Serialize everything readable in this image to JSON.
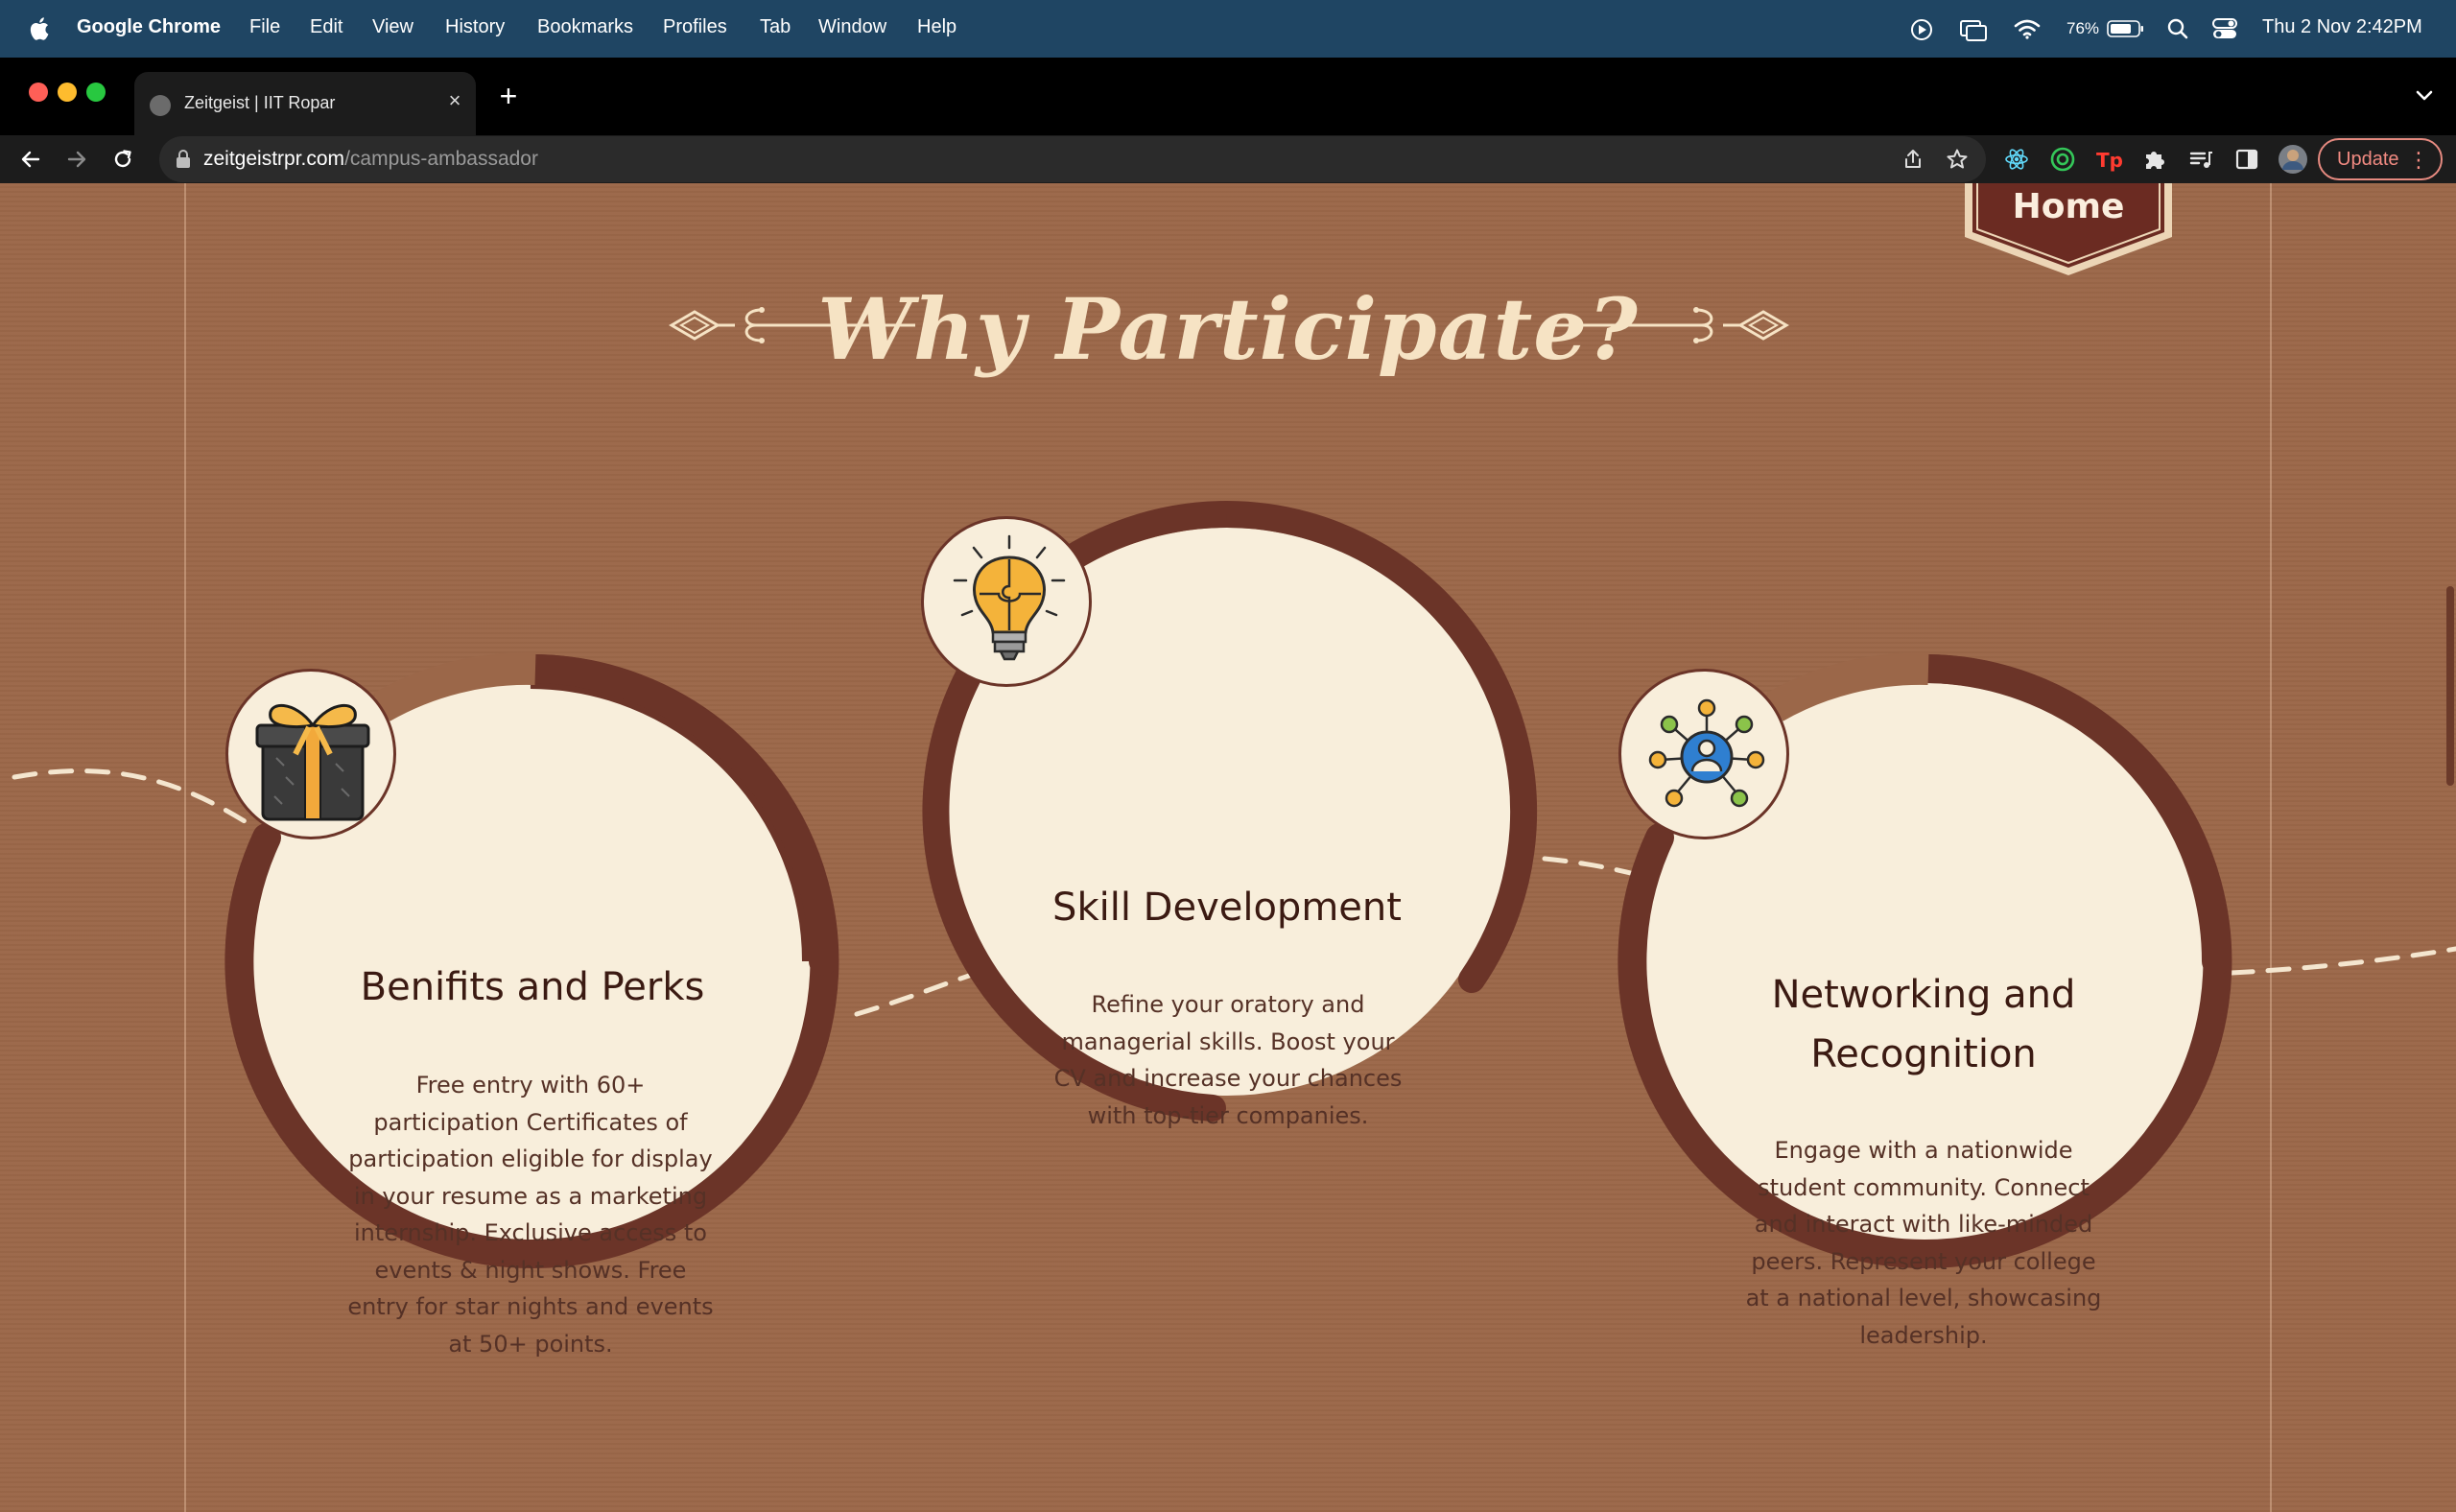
{
  "menubar": {
    "app_name": "Google Chrome",
    "items": [
      "File",
      "Edit",
      "View",
      "History",
      "Bookmarks",
      "Profiles",
      "Tab",
      "Window",
      "Help"
    ],
    "battery": "76%",
    "datetime": "Thu 2 Nov  2:42PM"
  },
  "browser": {
    "tab_title": "Zeitgeist | IIT Ropar",
    "url_host": "zeitgeistrpr.com",
    "url_path": "/campus-ambassador",
    "update_label": "Update"
  },
  "page": {
    "home_label": "Home",
    "section_title": "Why Participate?",
    "cards": [
      {
        "title": "Benifits and Perks",
        "body_lines": [
          "Free entry with 60+",
          "participation Certificates of",
          "participation eligible for display",
          "in your resume as a marketing",
          "internship. Exclusive access to",
          "events & night shows. Free",
          "entry for star nights and events",
          "at 50+ points."
        ],
        "icon": "gift-icon"
      },
      {
        "title": "Skill Development",
        "body_lines": [
          "Refine your oratory and",
          "managerial skills. Boost your",
          "CV and increase your chances",
          "with top-tier companies."
        ],
        "icon": "lightbulb-puzzle-icon"
      },
      {
        "title_lines": [
          "Networking and",
          "Recognition"
        ],
        "body_lines": [
          "Engage with a nationwide",
          "student community. Connect",
          "and interact with like-minded",
          "peers. Represent your college",
          "at a national level, showcasing",
          "leadership."
        ],
        "icon": "network-people-icon"
      }
    ]
  },
  "colors": {
    "page_bg": "#9b6749",
    "circle_fill": "#f8eedb",
    "ring": "#6b3428",
    "title": "#f6e3c4"
  }
}
